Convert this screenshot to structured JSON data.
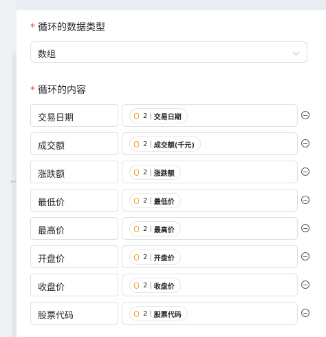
{
  "form": {
    "data_type": {
      "required_mark": "*",
      "label": "循环的数据类型",
      "value": "数组"
    },
    "content": {
      "required_mark": "*",
      "label": "循环的内容",
      "rows": [
        {
          "name": "交易日期",
          "chip_num": "2",
          "chip_sep": "|",
          "chip_text": "交易日期"
        },
        {
          "name": "成交额",
          "chip_num": "2",
          "chip_sep": "|",
          "chip_text": "成交额(千元)"
        },
        {
          "name": "涨跌额",
          "chip_num": "2",
          "chip_sep": "|",
          "chip_text": "涨跌额"
        },
        {
          "name": "最低价",
          "chip_num": "2",
          "chip_sep": "|",
          "chip_text": "最低价"
        },
        {
          "name": "最高价",
          "chip_num": "2",
          "chip_sep": "|",
          "chip_text": "最高价"
        },
        {
          "name": "开盘价",
          "chip_num": "2",
          "chip_sep": "|",
          "chip_text": "开盘价"
        },
        {
          "name": "收盘价",
          "chip_num": "2",
          "chip_sep": "|",
          "chip_text": "收盘价"
        },
        {
          "name": "股票代码",
          "chip_num": "2",
          "chip_sep": "|",
          "chip_text": "股票代码"
        }
      ]
    }
  },
  "icons": {
    "chip": "variable-icon",
    "remove": "minus-circle-icon",
    "dropdown": "chevron-down-icon",
    "drag": "drag-handle-icon"
  },
  "colors": {
    "required": "#f54a45",
    "chip_icon": "#f0a020",
    "border": "#dee0e3",
    "background": "#eef0f4"
  }
}
